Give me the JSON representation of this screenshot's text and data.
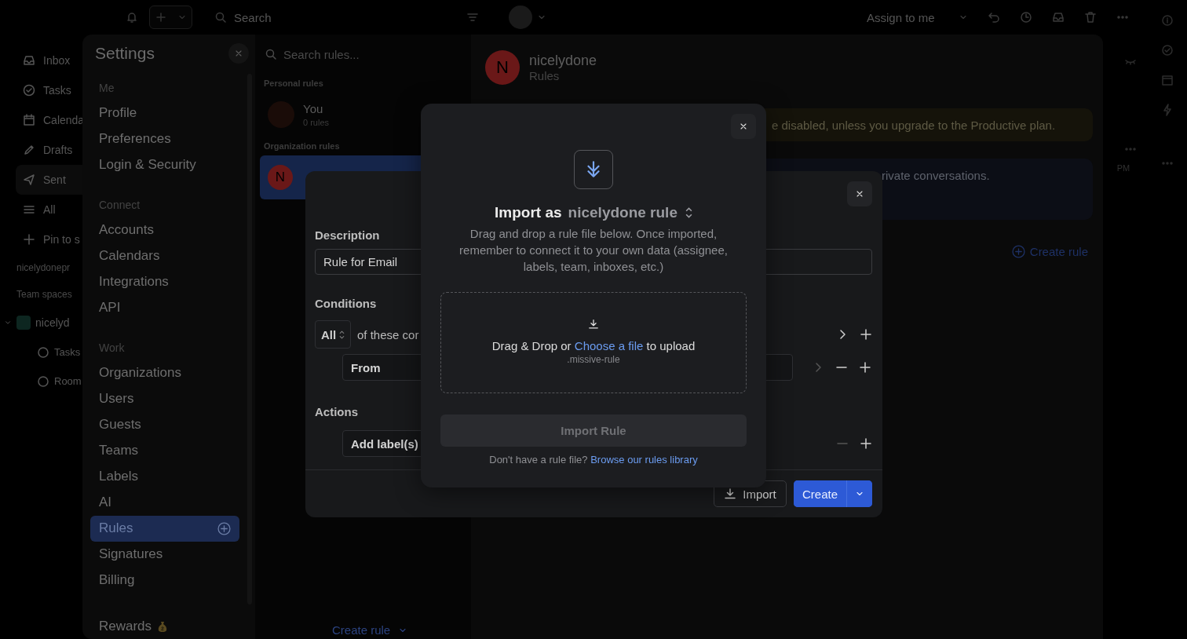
{
  "top_bar": {
    "search_placeholder": "Search",
    "assign_label": "Assign to me"
  },
  "sidebar": {
    "items": [
      {
        "label": "Inbox",
        "selected": false
      },
      {
        "label": "Tasks",
        "selected": false
      },
      {
        "label": "Calenda",
        "selected": false
      },
      {
        "label": "Drafts",
        "selected": false
      },
      {
        "label": "Sent",
        "selected": true
      },
      {
        "label": "All",
        "selected": false
      },
      {
        "label": "Pin to s",
        "selected": false
      }
    ],
    "account_label": "nicelydonepr",
    "team_spaces_label": "Team spaces",
    "team_spaces": [
      {
        "label": "nicelyd",
        "expanded": true,
        "children": [
          {
            "label": "Tasks"
          },
          {
            "label": "Room"
          }
        ]
      }
    ]
  },
  "background_row": {
    "time": "PM"
  },
  "settings": {
    "title": "Settings",
    "sections": [
      {
        "title": "Me",
        "items": [
          {
            "label": "Profile",
            "selected": false
          },
          {
            "label": "Preferences",
            "selected": false
          },
          {
            "label": "Login & Security",
            "selected": false
          }
        ]
      },
      {
        "title": "Connect",
        "items": [
          {
            "label": "Accounts",
            "selected": false
          },
          {
            "label": "Calendars",
            "selected": false
          },
          {
            "label": "Integrations",
            "selected": false
          },
          {
            "label": "API",
            "selected": false
          }
        ]
      },
      {
        "title": "Work",
        "items": [
          {
            "label": "Organizations",
            "selected": false
          },
          {
            "label": "Users",
            "selected": false
          },
          {
            "label": "Guests",
            "selected": false
          },
          {
            "label": "Teams",
            "selected": false
          },
          {
            "label": "Labels",
            "selected": false
          },
          {
            "label": "AI",
            "selected": false
          },
          {
            "label": "Rules",
            "selected": true
          },
          {
            "label": "Signatures",
            "selected": false
          },
          {
            "label": "Billing",
            "selected": false
          }
        ]
      }
    ],
    "rewards_label": "Rewards"
  },
  "rules_list": {
    "search_placeholder": "Search rules...",
    "groups": [
      {
        "title": "Personal rules",
        "items": [
          {
            "name": "You",
            "count": "0 rules",
            "selected": false
          }
        ]
      },
      {
        "title": "Organization rules",
        "items": [
          {
            "avatar": "N",
            "selected": true
          }
        ]
      }
    ],
    "create_label": "Create rule"
  },
  "rules_pane": {
    "avatar": "N",
    "name": "nicelydone",
    "subtitle": "Rules",
    "banners": [
      {
        "kind": "warning",
        "text": "e disabled, unless you upgrade to the Productive plan."
      },
      {
        "kind": "info",
        "text": "rivate conversations."
      }
    ],
    "create_label": "Create rule"
  },
  "create_dialog": {
    "description_label": "Description",
    "description_value": "Rule for Email",
    "conditions_label": "Conditions",
    "match_select": "All",
    "match_text": "of these cor",
    "condition_field": "From",
    "actions_label": "Actions",
    "action_field": "Add label(s)",
    "import_label": "Import",
    "create_label": "Create"
  },
  "import_dialog": {
    "title": "Import as",
    "target": "nicelydone rule",
    "description": "Drag and drop a rule file below. Once imported, remember to connect it to your own data (assignee, labels, team, inboxes, etc.)",
    "drop_before": "Drag & Drop or",
    "drop_link": "Choose a file",
    "drop_after": "to upload",
    "file_type": ".missive-rule",
    "import_button": {
      "label": "Import Rule",
      "disabled": true
    },
    "footer_text": "Don't have a rule file?",
    "footer_link": "Browse our rules library"
  }
}
